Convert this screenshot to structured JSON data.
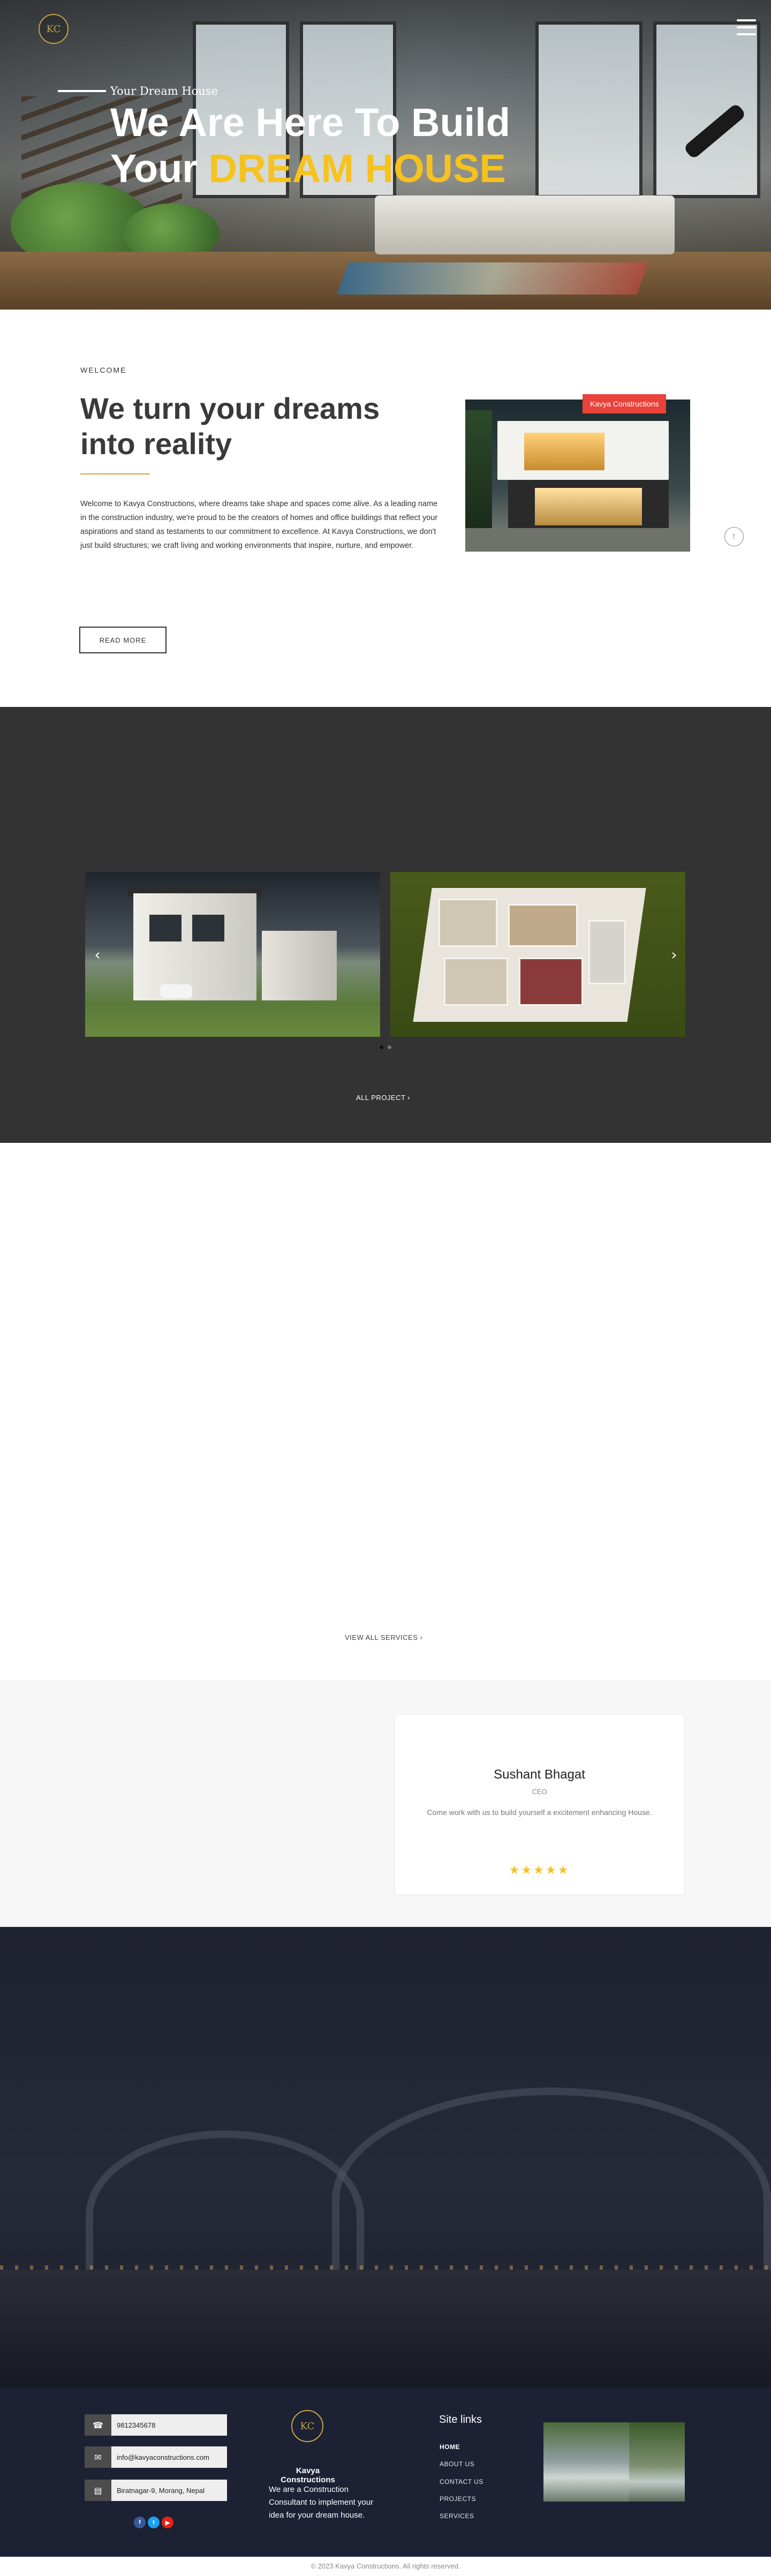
{
  "header": {
    "logo_text": "KC",
    "menu_icon": "hamburger-menu-icon"
  },
  "hero": {
    "tagline": "Your Dream House",
    "title_line1": "We Are Here To Build",
    "title_line2_prefix": "Your",
    "title_line2_highlight": "DREAM HOUSE"
  },
  "welcome": {
    "label": "WELCOME",
    "title": "We turn your dreams into reality",
    "text": "Welcome to Kavya Constructions, where dreams take shape and spaces come alive. As a leading name in the construction industry, we're proud to be the creators of homes and office buildings that reflect your aspirations and stand as testaments to our commitment to excellence. At Kavya Constructions, we don't just build structures; we craft living and working environments that inspire, nurture, and empower.",
    "read_more": "READ MORE",
    "image_badge": "Kavya Constructions"
  },
  "projects": {
    "prev_icon": "chevron-left-icon",
    "next_icon": "chevron-right-icon",
    "all_projects": "ALL PROJECT ›"
  },
  "services": {
    "view_all": "VIEW ALL SERVICES ›"
  },
  "testimonial": {
    "name": "Sushant Bhagat",
    "role": "CEO",
    "quote": "Come work with us to build yourself a excitement enhancing House.",
    "rating": 5,
    "stars": "★★★★★"
  },
  "footer": {
    "phone": "9812345678",
    "email": "info@kavyaconstructions.com",
    "address": "Biratnagar-9, Morang, Nepal",
    "company": "Kavya Constructions",
    "about": "We are a Construction Consultant to implement your idea for your dream house.",
    "links_title": "Site links",
    "links": [
      "HOME",
      "ABOUT US",
      "CONTACT US",
      "PROJECTS",
      "SERVICES"
    ],
    "social": [
      "facebook-icon",
      "twitter-icon",
      "youtube-icon"
    ],
    "copyright": "© 2023 Kavya Constructions. All rights reserved."
  },
  "colors": {
    "accent_yellow": "#f6c21d",
    "badge_red": "#e8423a",
    "dark_section": "#333333",
    "footer_bg": "#1c2134"
  }
}
